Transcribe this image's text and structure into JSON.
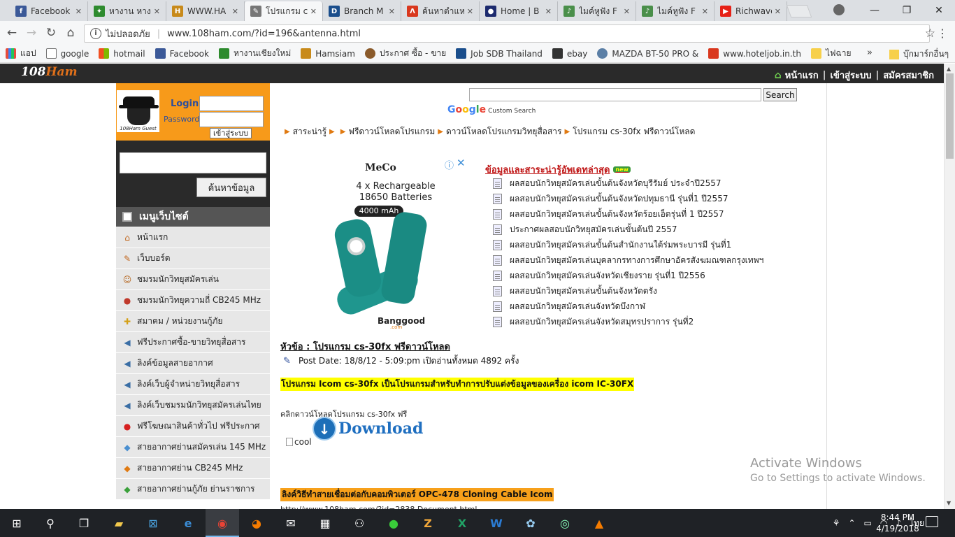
{
  "browser": {
    "tabs": [
      {
        "label": "Facebook",
        "icon": "facebook-icon",
        "color": "#3b5998"
      },
      {
        "label": "หางาน หาง",
        "icon": "jobs-icon",
        "color": "#2e8b2e"
      },
      {
        "label": "WWW.HA",
        "icon": "hamsiam-icon",
        "color": "#c88a1a"
      },
      {
        "label": "โปรแกรม c",
        "icon": "108ham-icon",
        "color": "#777777"
      },
      {
        "label": "Branch M",
        "icon": "branch-icon",
        "color": "#1a4e8c"
      },
      {
        "label": "ค้นหาตำแห",
        "icon": "hotel-icon",
        "color": "#d9381e"
      },
      {
        "label": "Home | B",
        "icon": "home-icon",
        "color": "#1c2a6e"
      },
      {
        "label": "ไมค์หูฟัง F",
        "icon": "mic-icon",
        "color": "#4a8f4a"
      },
      {
        "label": "ไมค์หูฟัง F",
        "icon": "mic-icon",
        "color": "#4a8f4a"
      },
      {
        "label": "Richwave",
        "icon": "youtube-icon",
        "color": "#e62117"
      }
    ],
    "omnibox": {
      "security": "ไม่ปลอดภัย",
      "url": "www.108ham.com/?id=196&antenna.html"
    },
    "bookmarks": [
      {
        "label": "แอป",
        "color": "#e74c3c"
      },
      {
        "label": "google",
        "color": "#ffffff"
      },
      {
        "label": "hotmail",
        "color": "#f25022"
      },
      {
        "label": "Facebook",
        "color": "#3b5998"
      },
      {
        "label": "หางานเชียงใหม่",
        "color": "#2e8b2e"
      },
      {
        "label": "Hamsiam",
        "color": "#c88a1a"
      },
      {
        "label": "ประกาศ ซื้อ - ขาย",
        "color": "#8a5a2a"
      },
      {
        "label": "Job SDB Thailand",
        "color": "#1a4e8c"
      },
      {
        "label": "ebay",
        "color": "#333333"
      },
      {
        "label": "MAZDA BT-50 PRO &",
        "color": "#5b7fa6"
      },
      {
        "label": "www.hoteljob.in.th",
        "color": "#d9381e"
      },
      {
        "label": "ไฟฉาย",
        "color": "#f7d04a"
      }
    ],
    "bookmarks_more": "»",
    "other_bookmarks": "บุ๊กมาร์กอื่นๆ"
  },
  "site": {
    "logo": {
      "prefix": "108",
      "suffix": "Ham"
    },
    "nav": {
      "home": "หน้าแรก",
      "login": "เข้าสู่ระบบ",
      "register": "สมัครสมาชิก",
      "divider": "|"
    },
    "login": {
      "label": "Login",
      "password_label": "Password",
      "button": "เข้าสู่ระบบ",
      "avatar_caption": "108Ham Guest"
    },
    "side_search": {
      "button": "ค้นหาข้อมูล"
    },
    "menu": {
      "title": "เมนูเว็บไซต์",
      "items": [
        {
          "label": "หน้าแรก",
          "icon": "home-icon",
          "glyph": "⌂",
          "color": "#c0641a"
        },
        {
          "label": "เว็บบอร์ด",
          "icon": "webboard-icon",
          "glyph": "✎",
          "color": "#c0641a"
        },
        {
          "label": "ชมรมนักวิทยุสมัครเล่น",
          "icon": "people-icon",
          "glyph": "☺",
          "color": "#b5651d"
        },
        {
          "label": "ชมรมนักวิทยุความถี่ CB245 MHz",
          "icon": "radio-icon",
          "glyph": "●",
          "color": "#c0392b"
        },
        {
          "label": "สมาคม / หน่วยงานกู้ภัย",
          "icon": "rescue-icon",
          "glyph": "✚",
          "color": "#d4a017"
        },
        {
          "label": "ฟรีประกาศซื้อ-ขายวิทยุสื่อสาร",
          "icon": "speaker-icon",
          "glyph": "◀",
          "color": "#3a6ea5"
        },
        {
          "label": "ลิงค์ข้อมูลสายอากาศ",
          "icon": "speaker-icon",
          "glyph": "◀",
          "color": "#3a6ea5"
        },
        {
          "label": "ลิงค์เว็บผู้จำหน่ายวิทยุสื่อสาร",
          "icon": "speaker-icon",
          "glyph": "◀",
          "color": "#3a6ea5"
        },
        {
          "label": "ลิงค์เว็บชมรมนักวิทยุสมัครเล่นไทย",
          "icon": "speaker-icon",
          "glyph": "◀",
          "color": "#3a6ea5"
        },
        {
          "label": "ฟรีโฆษณาสินค้าทั่วไป ฟรีประกาศ",
          "icon": "ads-icon",
          "glyph": "●",
          "color": "#d62020"
        },
        {
          "label": "สายอากาศย่านสมัครเล่น 145 MHz",
          "icon": "tag-icon",
          "glyph": "◆",
          "color": "#4a8fd0"
        },
        {
          "label": "สายอากาศย่าน CB245 MHz",
          "icon": "tag-icon",
          "glyph": "◆",
          "color": "#e07a12"
        },
        {
          "label": "สายอากาศย่านกู้ภัย ย่านราชการ",
          "icon": "tag-icon",
          "glyph": "◆",
          "color": "#3aa03a"
        }
      ]
    },
    "gcse": {
      "button": "Search",
      "brand": "Google",
      "custom": "Custom Search"
    },
    "breadcrumb": [
      "สาระน่ารู้",
      "ฟรีดาวน์โหลดโปรแกรม",
      "ดาวน์โหลดโปรแกรมวิทยุสื่อสาร",
      "โปรแกรม cs-30fx ฟรีดาวน์โหลด"
    ],
    "ad": {
      "brand": "MeCo",
      "line1": "4 x Rechargeable",
      "line2": "18650 Batteries",
      "capacity": "4000 mAh",
      "seller": "Banggood",
      "seller_domain": ".com",
      "info": "ⓘ",
      "close": "✕"
    },
    "news": {
      "heading": "ข้อมูลและสาระน่ารู้อัพเดทล่าสุด",
      "badge": "new",
      "items": [
        "ผลสอบนักวิทยุสมัครเล่นขั้นต้นจังหวัดบุรีรัมย์ ประจำปี2557",
        "ผลสอบนักวิทยุสมัครเล่นขั้นต้นจังหวัดปทุมธานี รุ่นที่1 ปี2557",
        "ผลสอบนักวิทยุสมัครเล่นขั้นต้นจังหวัดร้อยเอ็ดรุ่นที่ 1 ปี2557",
        "ประกาศผลสอบนักวิทยุสมัครเล่นขั้นต้นปี 2557",
        "ผลสอบนักวิทยุสมัครเล่นขั้นต้นสำนักงานใต้ร่มพระบารมี รุ่นที่1",
        "ผลสอบนักวิทยุสมัครเล่นบุคลากรทางการศึกษาอัครสังฆมณฑลกรุงเทพฯ",
        "ผลสอบนักวิทยุสมัครเล่นจังหวัดเชียงราย รุ่นที่1 ปี2556",
        "ผลสอบนักวิทยุสมัครเล่นขั้นต้นจังหวัดตรัง",
        "ผลสอบนักวิทยุสมัครเล่นจังหวัดบึงกาฬ",
        "ผลสอบนักวิทยุสมัครเล่นจังหวัดสมุทรปราการ รุ่นที่2"
      ]
    },
    "post": {
      "title": "หัวข้อ : โปรแกรม cs-30fx ฟรีดาวน์โหลด",
      "meta": "Post Date:  18/8/12 - 5:09:pm เปิดอ่านทั้งหมด 4892 ครั้ง",
      "highlight": "โปรแกรม Icom  cs-30fx เป็นโปรแกรมสำหรับทำการปรับแต่งข้อมูลของเครื่อง icom IC-30FX",
      "download_text": "คลิกดาวน์โหลดโปรแกรม cs-30fx ฟรี",
      "download_label": "Download",
      "img_alt": "cool",
      "related": "ลิงค์วิธีทำสายเชื่อมต่อกับคอมพิวเตอร์  OPC-478 Cloning Cable Icom",
      "related_url": "http://www.108ham.com/?id=2838 Document.html"
    }
  },
  "watermark": {
    "title": "Activate Windows",
    "subtitle": "Go to Settings to activate Windows."
  },
  "taskbar": {
    "tray_lang": "ไทย",
    "time": "8:44 PM",
    "date": "4/19/2018"
  },
  "colors": {
    "accent_orange": "#f79a1a",
    "dark_bar": "#2a2a2a",
    "news_red": "#c01818",
    "link_blue": "#2d4e9b"
  }
}
